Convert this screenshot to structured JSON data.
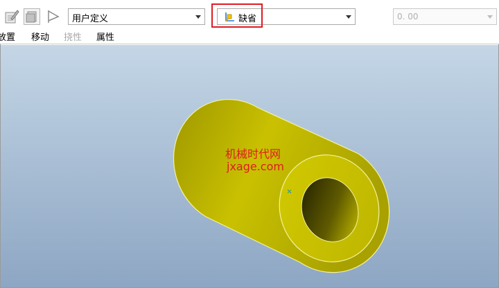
{
  "toolbar": {
    "icons": [
      "edit-icon",
      "layer-icon",
      "flag-icon"
    ],
    "view_select": {
      "value": "用户定义"
    },
    "style_select": {
      "value": "缺省",
      "icon": "view-axes-icon"
    },
    "number_field": {
      "value": "0. 00"
    }
  },
  "tabs": [
    {
      "label": "放置",
      "enabled": true
    },
    {
      "label": "移动",
      "enabled": true
    },
    {
      "label": "挠性",
      "enabled": false
    },
    {
      "label": "属性",
      "enabled": true
    }
  ],
  "viewport": {
    "watermark_line1": "机械时代网",
    "watermark_line2": "jxage.com",
    "model_color": "#c8c000",
    "background_top": "#c4d6e6",
    "background_bottom": "#8da6c3"
  },
  "highlight_color": "#e01a22"
}
